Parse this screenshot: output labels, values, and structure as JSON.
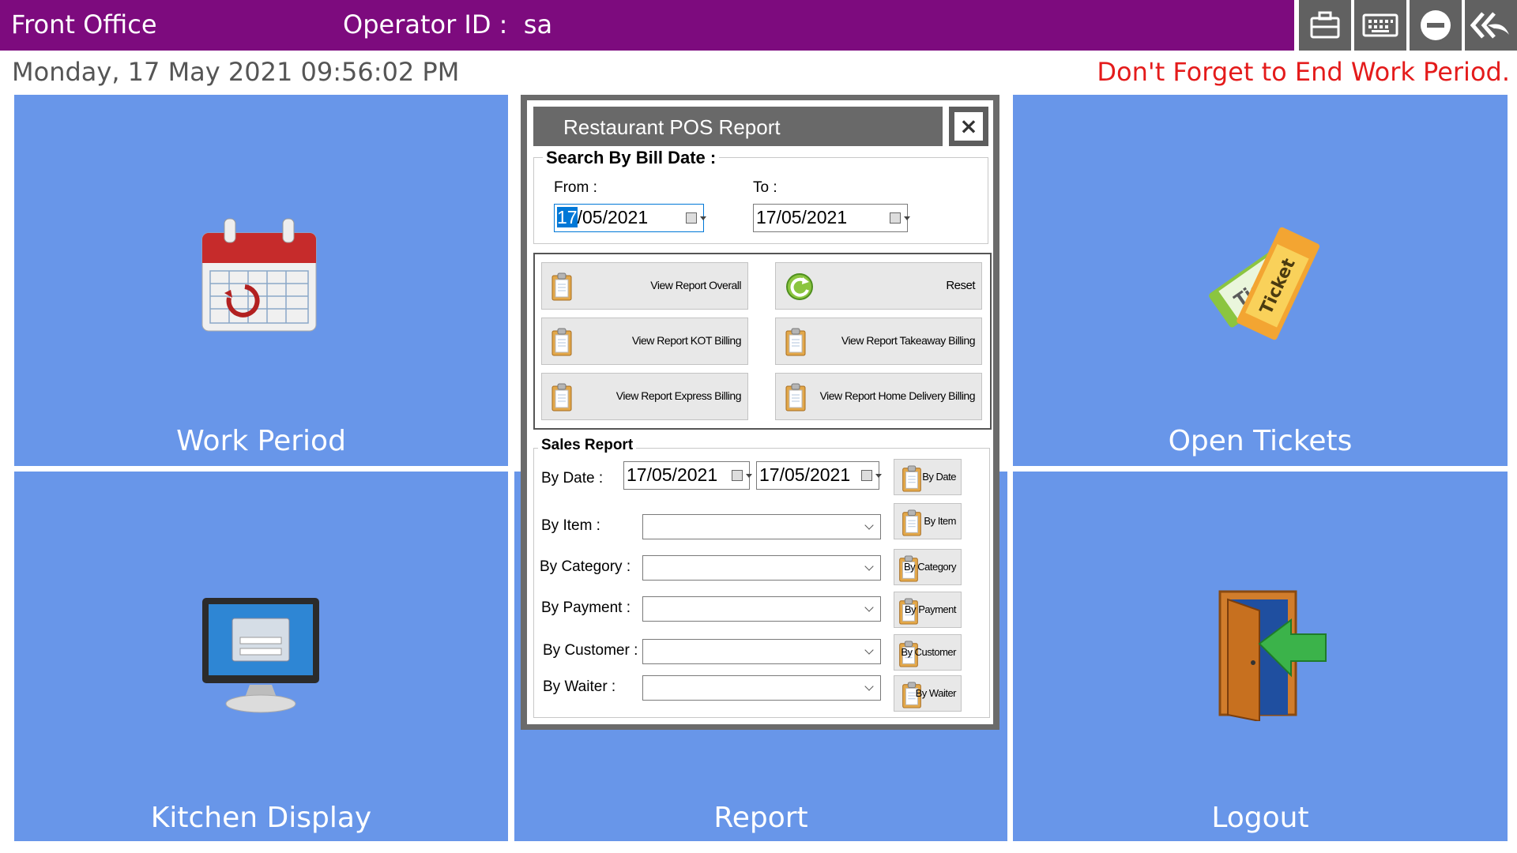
{
  "header": {
    "app_title": "Front Office",
    "operator_label": "Operator ID :  sa",
    "toolbar": {
      "briefcase": "briefcase-icon",
      "keyboard": "keyboard-icon",
      "minimize": "minimize-icon",
      "back": "back-icon"
    }
  },
  "status": {
    "datetime": "Monday, 17 May 2021 09:56:02 PM",
    "reminder": "Don't Forget to End Work Period."
  },
  "tiles": {
    "work_period": "Work Period",
    "open_tickets": "Open Tickets",
    "kitchen_display": "Kitchen Display",
    "report": "Report",
    "logout": "Logout"
  },
  "dialog": {
    "title": "Restaurant POS Report",
    "close": "×",
    "bill_date": {
      "group_label": "Search By Bill Date :",
      "from_label": "From :",
      "to_label": "To :",
      "from_day": "17",
      "from_rest": "/05/2021",
      "to_value": "17/05/2021"
    },
    "buttons": {
      "overall": "View Report Overall",
      "reset": "Reset",
      "kot": "View Report KOT Billing",
      "takeaway": "View Report Takeaway Billing",
      "express": "View Report Express Billing",
      "home_delivery": "View Report Home Delivery Billing"
    },
    "sales": {
      "group_label": "Sales Report",
      "by_date_label": "By Date :",
      "date_from": "17/05/2021",
      "date_to": "17/05/2021",
      "by_item_label": "By Item :",
      "by_category_label": "By Category :",
      "by_payment_label": "By Payment :",
      "by_customer_label": "By Customer :",
      "by_waiter_label": "By Waiter :",
      "btn_date": "By Date",
      "btn_item": "By Item",
      "btn_category": "By Category",
      "btn_payment": "By Payment",
      "btn_customer": "By Customer",
      "btn_waiter": "By Waiter"
    }
  },
  "colors": {
    "titlebar": "#7d0b7e",
    "tile": "#6896e9",
    "reminder": "#e41b1b",
    "toolbar_button": "#616161"
  }
}
